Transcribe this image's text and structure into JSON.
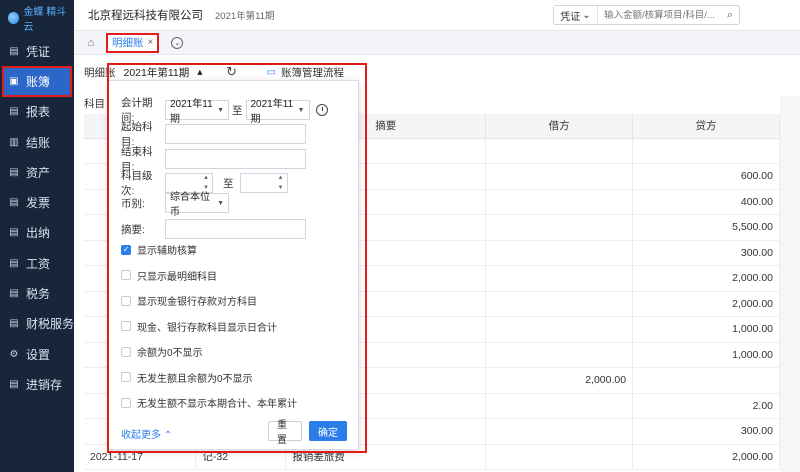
{
  "app": {
    "logo_text": "金蝶 精斗云"
  },
  "sidebar": {
    "items": [
      {
        "label": "凭证",
        "icon": "voucher-icon",
        "glyph": "▤"
      },
      {
        "label": "账簿",
        "icon": "ledger-icon",
        "glyph": "▣"
      },
      {
        "label": "报表",
        "icon": "report-icon",
        "glyph": "▤"
      },
      {
        "label": "结账",
        "icon": "closing-icon",
        "glyph": "▥"
      },
      {
        "label": "资产",
        "icon": "asset-icon",
        "glyph": "▤"
      },
      {
        "label": "发票",
        "icon": "invoice-icon",
        "glyph": "▤"
      },
      {
        "label": "出纳",
        "icon": "cashier-icon",
        "glyph": "▤"
      },
      {
        "label": "工资",
        "icon": "salary-icon",
        "glyph": "▤"
      },
      {
        "label": "税务",
        "icon": "tax-icon",
        "glyph": "▤"
      },
      {
        "label": "财税服务",
        "icon": "service-icon",
        "glyph": "▤"
      },
      {
        "label": "设置",
        "icon": "settings-icon",
        "glyph": "⚙"
      },
      {
        "label": "进销存",
        "icon": "inventory-icon",
        "glyph": "▤"
      }
    ]
  },
  "header": {
    "company": "北京程远科技有限公司",
    "period": "2021年第11期",
    "search_type": "凭证",
    "search_placeholder": "输入金额/核算项目/科目/..."
  },
  "tabs": {
    "active_label": "明细账"
  },
  "toolbar": {
    "label": "明细账",
    "period": "2021年第11期",
    "flow_label": "账簿管理流程"
  },
  "table": {
    "subject_label": "科目",
    "headers": [
      "",
      "",
      "摘要",
      "借方",
      "贷方"
    ],
    "rows": [
      {
        "date": "",
        "no": "",
        "summary": "",
        "dr": "",
        "cr": ""
      },
      {
        "date": "",
        "no": "",
        "summary": "",
        "dr": "",
        "cr": "600.00"
      },
      {
        "date": "",
        "no": "",
        "summary": "",
        "dr": "",
        "cr": "400.00"
      },
      {
        "date": "",
        "no": "",
        "summary": "费",
        "dr": "",
        "cr": "5,500.00"
      },
      {
        "date": "",
        "no": "",
        "summary": "",
        "dr": "",
        "cr": "300.00"
      },
      {
        "date": "",
        "no": "",
        "summary": "",
        "dr": "",
        "cr": "2,000.00"
      },
      {
        "date": "",
        "no": "",
        "summary": "",
        "dr": "",
        "cr": "2,000.00"
      },
      {
        "date": "",
        "no": "",
        "summary": "",
        "dr": "",
        "cr": "1,000.00"
      },
      {
        "date": "",
        "no": "",
        "summary": "",
        "dr": "",
        "cr": "1,000.00"
      },
      {
        "date": "",
        "no": "",
        "summary": "",
        "dr": "2,000.00",
        "cr": ""
      },
      {
        "date": "",
        "no": "",
        "summary": "",
        "dr": "",
        "cr": "2.00"
      },
      {
        "date": "",
        "no": "",
        "summary": "",
        "dr": "",
        "cr": "300.00"
      },
      {
        "date": "2021-11-17",
        "no": "记-32",
        "summary": "报销差旅费",
        "dr": "",
        "cr": "2,000.00"
      }
    ]
  },
  "panel": {
    "period_label": "会计期间:",
    "period_from": "2021年11期",
    "to_label": "至",
    "period_to": "2021年11期",
    "start_subject_label": "起始科目:",
    "end_subject_label": "结束科目:",
    "level_label": "科目级次:",
    "level_to_label": "至",
    "currency_label": "币别:",
    "currency_value": "综合本位币",
    "summary_label": "摘要:",
    "options": [
      {
        "label": "显示辅助核算",
        "checked": true
      },
      {
        "label": "只显示最明细科目",
        "checked": false
      },
      {
        "label": "显示现金银行存款对方科目",
        "checked": false
      },
      {
        "label": "现金、银行存款科目显示日合计",
        "checked": false
      },
      {
        "label": "余额为0不显示",
        "checked": false
      },
      {
        "label": "无发生额且余额为0不显示",
        "checked": false
      },
      {
        "label": "无发生额不显示本期合计、本年累计",
        "checked": false
      }
    ],
    "collapse_label": "收起更多",
    "reset_label": "重置",
    "ok_label": "确定"
  },
  "colors": {
    "accent": "#2b7de9",
    "sidebar_bg": "#17263a",
    "highlight": "#e21b1b"
  }
}
